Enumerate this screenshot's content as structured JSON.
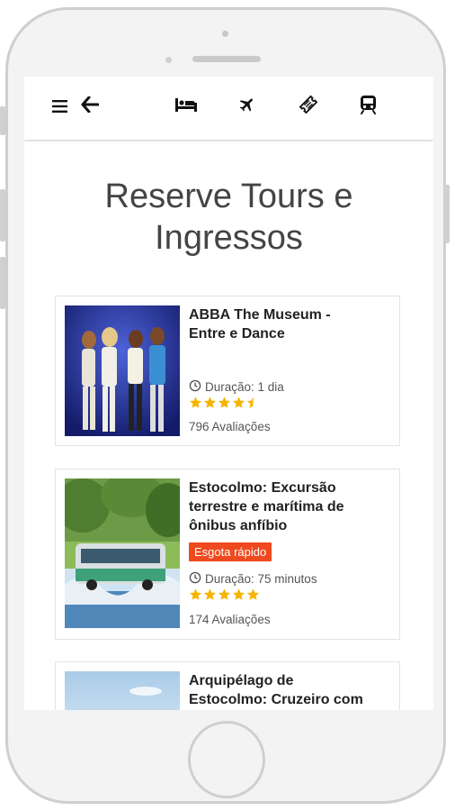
{
  "header": {
    "icons": [
      "menu-icon",
      "back-arrow-icon",
      "hotel-bed-icon",
      "flight-icon",
      "ticket-icon",
      "train-icon"
    ]
  },
  "page": {
    "title_line1": "Reserve Tours e",
    "title_line2": "Ingressos"
  },
  "cards": [
    {
      "title_line1": "ABBA The Museum -",
      "title_line2": "Entre e Dance",
      "duration": "Duração: 1 dia",
      "rating": 4.5,
      "reviews": "796 Avaliações"
    },
    {
      "title_line1": "Estocolmo: Excursão",
      "title_line2": "terrestre e marítima de",
      "title_line3": "ônibus anfíbio",
      "badge": "Esgota rápido",
      "duration": "Duração: 75 minutos",
      "rating": 5,
      "reviews": "174 Avaliações"
    },
    {
      "title_line1": "Arquipélago de",
      "title_line2": "Estocolmo: Cruzeiro com"
    }
  ],
  "colors": {
    "star": "#f5b400",
    "badge": "#ef4a1f"
  }
}
